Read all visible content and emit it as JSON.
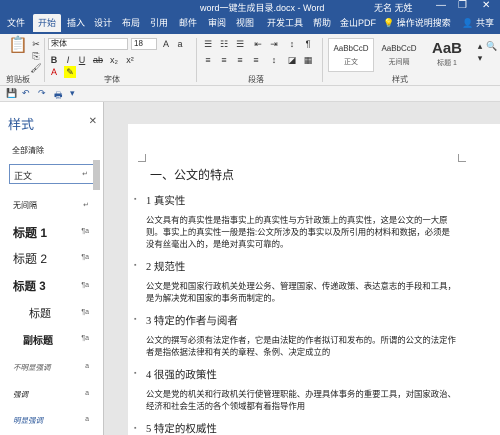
{
  "title_bar": {
    "document_title": "word一键生成目录.docx - Word",
    "user": "无名 无姓",
    "min": "—",
    "restore": "❐",
    "close": "✕"
  },
  "tabs": [
    "文件",
    "开始",
    "插入",
    "设计",
    "布局",
    "引用",
    "邮件",
    "审阅",
    "视图",
    "开发工具",
    "帮助",
    "金山PDF"
  ],
  "help_text": "操作说明搜索",
  "share_text": "共享",
  "ribbon": {
    "font_name": "宋体",
    "font_size": "18",
    "groups": {
      "clipboard": "剪贴板",
      "font": "字体",
      "paragraph": "段落",
      "styles": "样式"
    },
    "style_gallery": [
      {
        "sample": "AaBbCcD",
        "name": "正文"
      },
      {
        "sample": "AaBbCcD",
        "name": "无间隔"
      },
      {
        "sample": "AaB",
        "name": "标题 1"
      }
    ]
  },
  "styles_pane": {
    "title": "样式",
    "clear_all": "全部清除",
    "items": [
      {
        "label": "正文",
        "mark": "↵"
      },
      {
        "label": "无间隔",
        "mark": "↵"
      },
      {
        "label": "标题 1",
        "mark": "¶a"
      },
      {
        "label": "标题 2",
        "mark": "¶a"
      },
      {
        "label": "标题 3",
        "mark": "¶a"
      },
      {
        "label": "标题",
        "mark": "¶a"
      },
      {
        "label": "副标题",
        "mark": "¶a"
      },
      {
        "label": "不明显强调",
        "mark": "a"
      },
      {
        "label": "强调",
        "mark": "a"
      },
      {
        "label": "明显强调",
        "mark": "a"
      }
    ]
  },
  "document": {
    "h1": "一、公文的特点",
    "sections": [
      {
        "heading": "1  真实性",
        "body": "公文具有的真实性是指事实上的真实性与方针政策上的真实性，这是公文的一大原则。事实上的真实性一般是指:公文所涉及的事实以及所引用的材料和数据，必须是没有丝毫出入的，是绝对真实可靠的。"
      },
      {
        "heading": "2  规范性",
        "body": "公文是党和国家行政机关处理公务、管理国家、传递政策、表达意志的手段和工具，是为解决党和国家的事务而制定的。"
      },
      {
        "heading": "3  特定的作者与阅者",
        "body": "公文的撰写必须有法定作者，它是由法定的作者拟订和发布的。所谓的公文的法定作者是指依据法律和有关的章程、条例、决定成立的"
      },
      {
        "heading": "4  很强的政策性",
        "body": "公文是党的机关和行政机关行使管理职能、办理具体事务的重要工具，对国家政治、经济和社会生活的各个领域都有着指导作用"
      },
      {
        "heading": "5  特定的权威性",
        "body": ""
      }
    ]
  }
}
